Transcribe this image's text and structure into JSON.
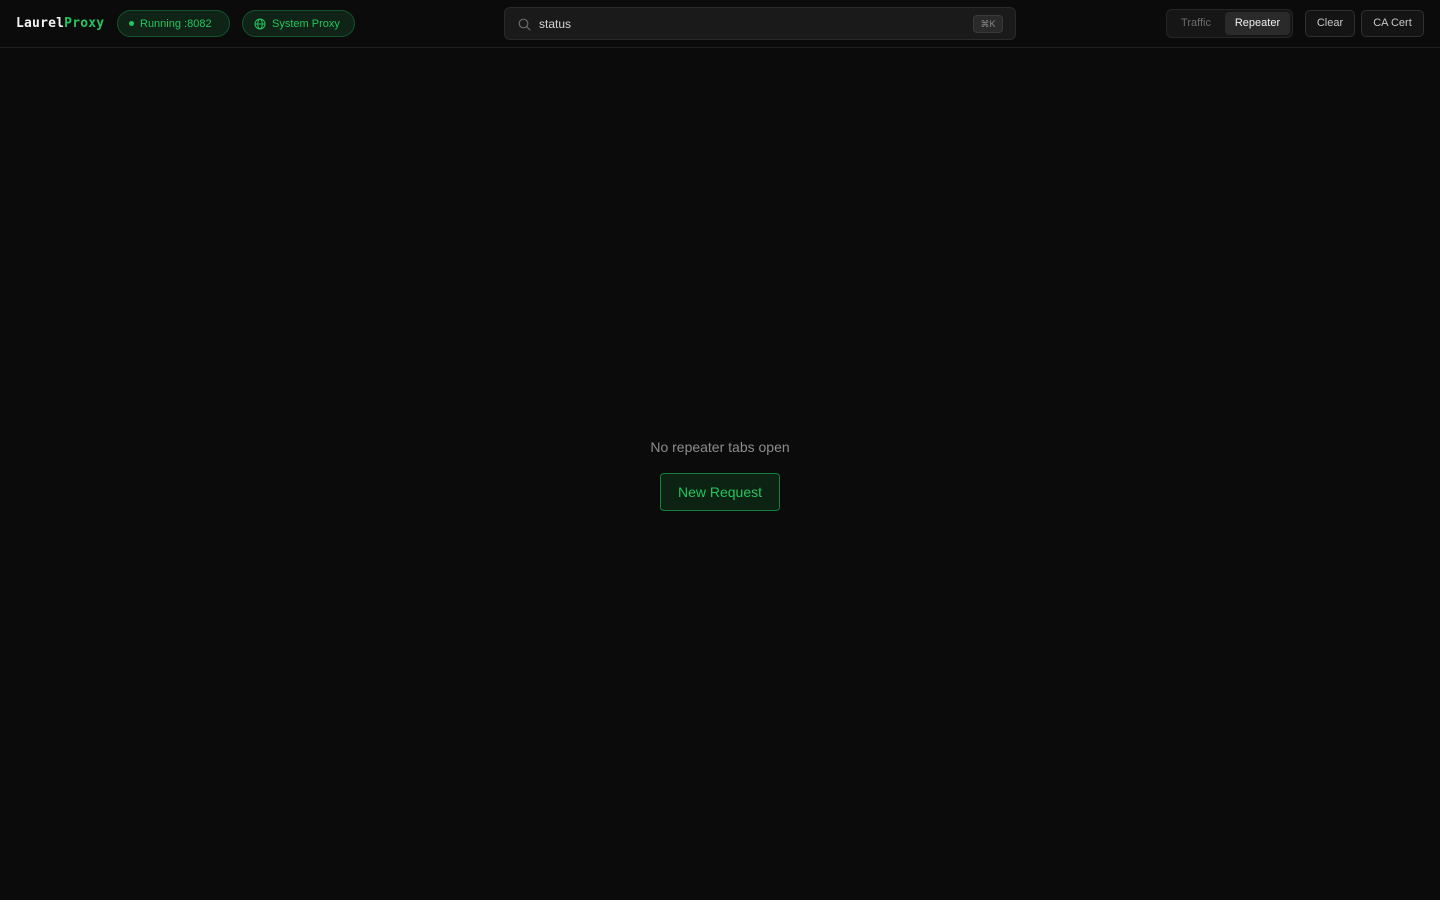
{
  "app": {
    "logo_part1": "Laurel",
    "logo_part2": "Proxy",
    "accent_color": "#22c55e"
  },
  "header": {
    "running_label": "Running :8082",
    "system_proxy_label": "System Proxy",
    "search": {
      "value": "status",
      "shortcut": "⌘K",
      "icon": "search-icon"
    },
    "tabs": [
      {
        "label": "Traffic",
        "active": false
      },
      {
        "label": "Repeater",
        "active": true
      }
    ],
    "clear_label": "Clear",
    "ca_cert_label": "CA Cert"
  },
  "main": {
    "empty_message": "No repeater tabs open",
    "new_request_label": "New Request"
  }
}
